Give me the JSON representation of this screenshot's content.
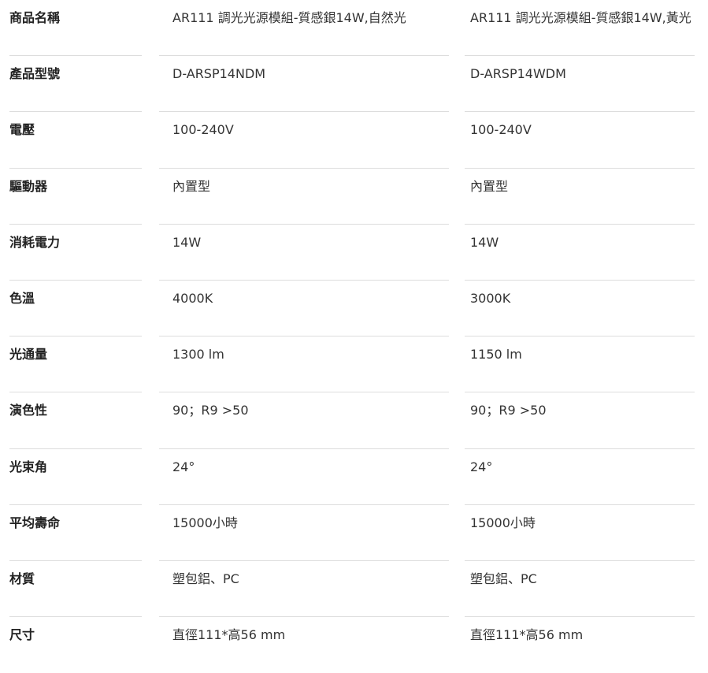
{
  "table": {
    "rows": [
      {
        "label": "商品名稱",
        "a": "AR111 調光光源模組-質感銀14W,自然光",
        "b": "AR111 調光光源模組-質感銀14W,黃光"
      },
      {
        "label": "產品型號",
        "a": "D-ARSP14NDM",
        "b": "D-ARSP14WDM"
      },
      {
        "label": "電壓",
        "a": "100-240V",
        "b": "100-240V"
      },
      {
        "label": "驅動器",
        "a": "內置型",
        "b": "內置型"
      },
      {
        "label": "消耗電力",
        "a": "14W",
        "b": "14W"
      },
      {
        "label": "色溫",
        "a": "4000K",
        "b": "3000K"
      },
      {
        "label": "光通量",
        "a": "1300 lm",
        "b": "1150 lm"
      },
      {
        "label": "演色性",
        "a": "90；R9 >50",
        "b": "90；R9 >50"
      },
      {
        "label": "光束角",
        "a": "24°",
        "b": "24°"
      },
      {
        "label": "平均壽命",
        "a": "15000小時",
        "b": "15000小時"
      },
      {
        "label": "材質",
        "a": "塑包鋁、PC",
        "b": "塑包鋁、PC"
      },
      {
        "label": "尺寸",
        "a": "直徑111*高56 mm",
        "b": "直徑111*高56 mm"
      }
    ]
  }
}
